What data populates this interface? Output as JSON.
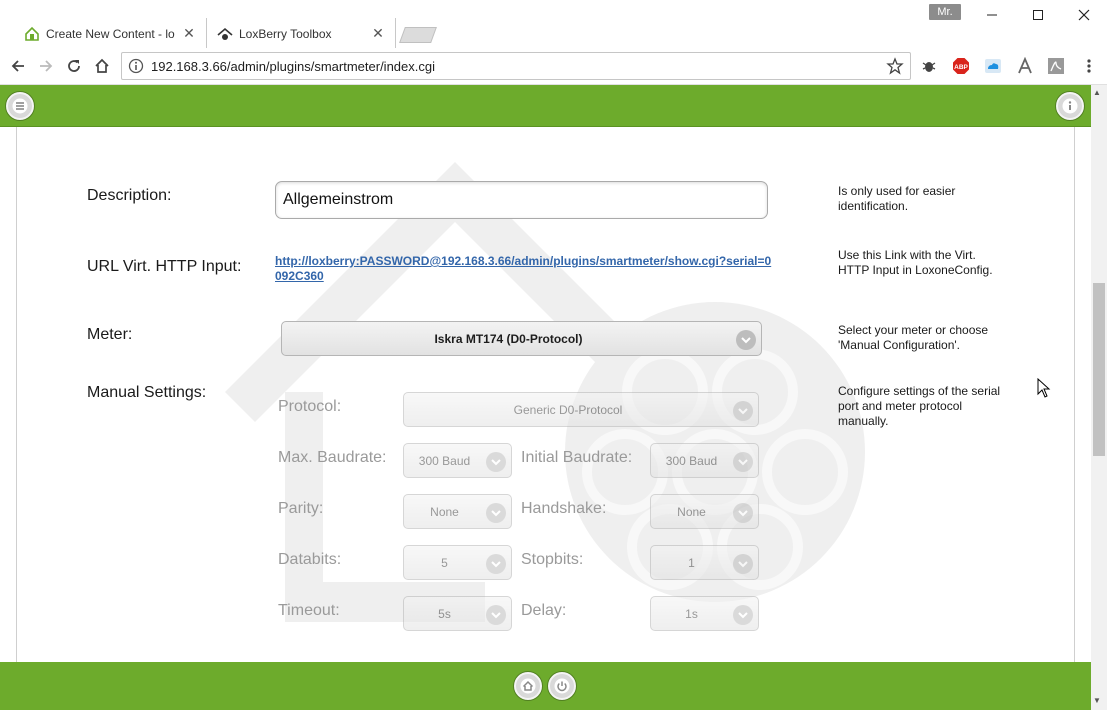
{
  "browser": {
    "tabs": [
      {
        "title": "Create New Content - lo"
      },
      {
        "title": "LoxBerry Toolbox"
      }
    ],
    "user_badge": "Mr.",
    "url": "192.168.3.66/admin/plugins/smartmeter/index.cgi"
  },
  "form": {
    "description": {
      "label": "Description:",
      "value": "Allgemeinstrom",
      "help": "Is only used for easier identification."
    },
    "url_input": {
      "label": "URL Virt. HTTP Input:",
      "link": "http://loxberry:PASSWORD@192.168.3.66/admin/plugins/smartmeter/show.cgi?serial=0092C360",
      "help": "Use this Link with the Virt. HTTP Input in LoxoneConfig."
    },
    "meter": {
      "label": "Meter:",
      "value": "Iskra MT174 (D0-Protocol)",
      "help": "Select your meter or choose 'Manual Configuration'."
    },
    "manual": {
      "label": "Manual Settings:",
      "help": "Configure settings of the serial port and meter protocol manually.",
      "protocol": {
        "label": "Protocol:",
        "value": "Generic D0-Protocol"
      },
      "max_baudrate": {
        "label": "Max. Baudrate:",
        "value": "300 Baud"
      },
      "initial_baudrate": {
        "label": "Initial Baudrate:",
        "value": "300 Baud"
      },
      "parity": {
        "label": "Parity:",
        "value": "None"
      },
      "handshake": {
        "label": "Handshake:",
        "value": "None"
      },
      "databits": {
        "label": "Databits:",
        "value": "5"
      },
      "stopbits": {
        "label": "Stopbits:",
        "value": "1"
      },
      "timeout": {
        "label": "Timeout:",
        "value": "5s"
      },
      "delay": {
        "label": "Delay:",
        "value": "1s"
      }
    }
  },
  "colors": {
    "header_green": "#6dab2c",
    "link_blue": "#3366aa"
  }
}
